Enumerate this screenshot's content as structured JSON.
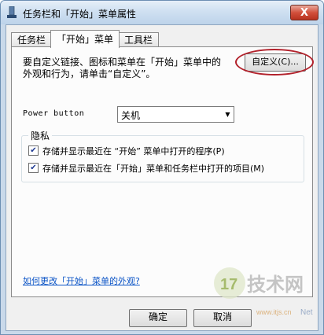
{
  "window": {
    "title": "任务栏和「开始」菜单属性",
    "close_label": "X"
  },
  "tabs": [
    {
      "label": "任务栏",
      "active": false
    },
    {
      "label": "「开始」菜单",
      "active": true
    },
    {
      "label": "工具栏",
      "active": false
    }
  ],
  "start_menu": {
    "description_line1": "要自定义链接、图标和菜单在「开始」菜单中的",
    "description_line2": "外观和行为，请单击“自定义”。",
    "customize_label": "自定义(C)..."
  },
  "power_button": {
    "label": "Power button",
    "value": "关机"
  },
  "privacy": {
    "title": "隐私",
    "items": [
      {
        "label": "存储并显示最近在 “开始” 菜单中打开的程序(P)",
        "checked": true
      },
      {
        "label": "存储并显示最近在「开始」菜单和任务栏中打开的项目(M)",
        "checked": true
      }
    ]
  },
  "help_link": "如何更改「开始」菜单的外观?",
  "buttons": {
    "ok": "确定",
    "cancel": "取消"
  },
  "watermark": {
    "logo_digits": "17",
    "logo_text": "技术网",
    "site": "www.itjs.cn",
    "corner": "Net"
  },
  "colors": {
    "highlight_oval": "#b2212b",
    "link": "#0b54c6",
    "close_button": "#c8402c"
  }
}
